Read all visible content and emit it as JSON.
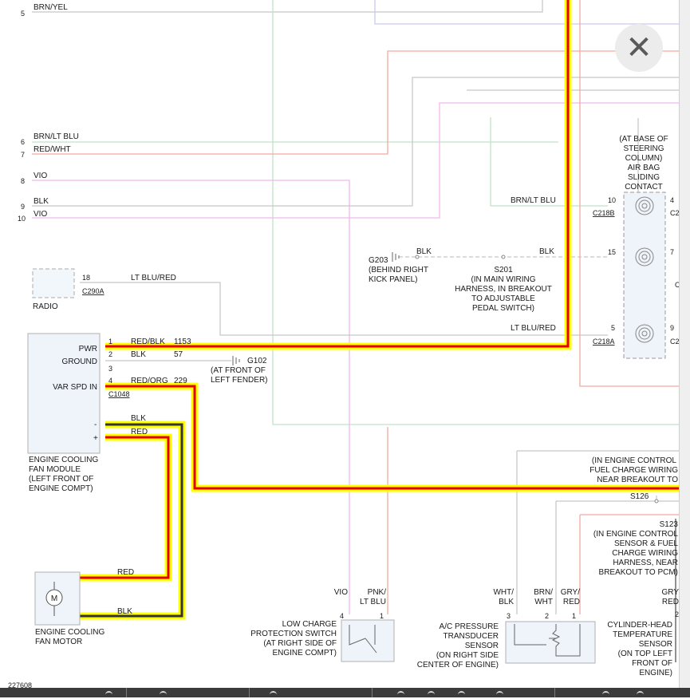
{
  "close_label": "✕",
  "figure_id": "227608",
  "colors": {
    "highlight": "#ffff00",
    "wire_red": "#e60000",
    "wire_dark": "#333333",
    "wire_pink": "#f4a9a0",
    "wire_green": "#bfe3c8",
    "wire_violet": "#f0b8ef",
    "wire_gray": "#c8c8c8",
    "wire_lavender": "#c9c9ee"
  },
  "top_wire": {
    "label": "BRN/YEL",
    "pin": "5"
  },
  "left_wires": [
    {
      "pin": "6",
      "label": "BRN/LT BLU"
    },
    {
      "pin": "7",
      "label": "RED/WHT"
    },
    {
      "pin": "8",
      "label": "VIO"
    },
    {
      "pin": "9",
      "label": "BLK"
    },
    {
      "pin": "10",
      "label": "VIO"
    }
  ],
  "radio": {
    "name": "RADIO",
    "pin": "18",
    "connector": "C290A",
    "wire": "LT BLU/RED"
  },
  "fan_module": {
    "name": [
      "ENGINE COOLING",
      "FAN MODULE",
      "(LEFT FRONT OF",
      "ENGINE COMPT)"
    ],
    "connector": "C1048",
    "pins": [
      {
        "label": "PWR",
        "pin": "1",
        "color": "RED/BLK",
        "circuit": "1153"
      },
      {
        "label": "GROUND",
        "pin": "2",
        "color": "BLK",
        "circuit": "57"
      },
      {
        "label": "",
        "pin": "3",
        "color": "",
        "circuit": ""
      },
      {
        "label": "VAR SPD IN",
        "pin": "4",
        "color": "RED/ORG",
        "circuit": "229"
      }
    ],
    "minus": "-",
    "plus": "+",
    "minus_wire": "BLK",
    "plus_wire": "RED"
  },
  "g102": {
    "name": "G102",
    "desc": [
      "(AT FRONT OF",
      "LEFT FENDER)"
    ]
  },
  "g203": {
    "name": "G203",
    "desc": [
      "(BEHIND RIGHT",
      "KICK PANEL)"
    ],
    "wire": "BLK"
  },
  "s201": {
    "name": "S201",
    "desc": [
      "(IN MAIN WIRING",
      "HARNESS, IN BREAKOUT",
      "TO ADJUSTABLE",
      "PEDAL SWITCH)"
    ],
    "wire": "BLK"
  },
  "airbag": {
    "desc": [
      "(AT BASE OF",
      "STEERING",
      "COLUMN)",
      "AIR BAG",
      "SLIDING",
      "CONTACT"
    ],
    "pins": [
      {
        "pin": "10",
        "wire": "BRN/LT BLU",
        "connector": "C218B",
        "right_pin": "4",
        "right_conn": "C2"
      },
      {
        "pin": "15",
        "wire": "BLK",
        "connector": "",
        "right_pin": "7",
        "right_conn": ""
      },
      {
        "pin": "5",
        "wire": "LT BLU/RED",
        "connector": "C218A",
        "right_pin": "9",
        "right_conn": "C2"
      }
    ],
    "partial_c": "C"
  },
  "fan_motor": {
    "name": [
      "ENGINE COOLING",
      "FAN MOTOR"
    ],
    "symbol": "M",
    "red_wire": "RED",
    "blk_wire": "BLK"
  },
  "engine_control": {
    "desc": [
      "(IN ENGINE CONTROL",
      "FUEL CHARGE WIRING",
      "NEAR BREAKOUT TO"
    ],
    "s126": "S126"
  },
  "s123": {
    "name": "S123",
    "desc": [
      "(IN ENGINE CONTROL",
      "SENSOR & FUEL",
      "CHARGE WIRING",
      "HARNESS, NEAR",
      "BREAKOUT TO PCM)"
    ]
  },
  "low_charge": {
    "wires": [
      {
        "pin": "4",
        "label": [
          "VIO"
        ]
      },
      {
        "pin": "1",
        "label": [
          "PNK/",
          "LT BLU"
        ]
      }
    ],
    "name": [
      "LOW CHARGE",
      "PROTECTION SWITCH",
      "(AT RIGHT SIDE OF",
      "ENGINE COMPT)"
    ]
  },
  "ac_pressure": {
    "wires": [
      {
        "pin": "3",
        "label": [
          "WHT/",
          "BLK"
        ]
      },
      {
        "pin": "2",
        "label": [
          "BRN/",
          "WHT"
        ]
      },
      {
        "pin": "1",
        "label": [
          "GRY/",
          "RED"
        ]
      }
    ],
    "name": [
      "A/C PRESSURE",
      "TRANSDUCER",
      "SENSOR",
      "(ON RIGHT SIDE",
      "CENTER OF ENGINE)"
    ]
  },
  "cht": {
    "wire": [
      "GRY",
      "RED"
    ],
    "pin": "2",
    "name": [
      "CYLINDER-HEAD",
      "TEMPERATURE",
      "SENSOR",
      "(ON TOP LEFT",
      "FRONT OF",
      "ENGINE)"
    ]
  }
}
